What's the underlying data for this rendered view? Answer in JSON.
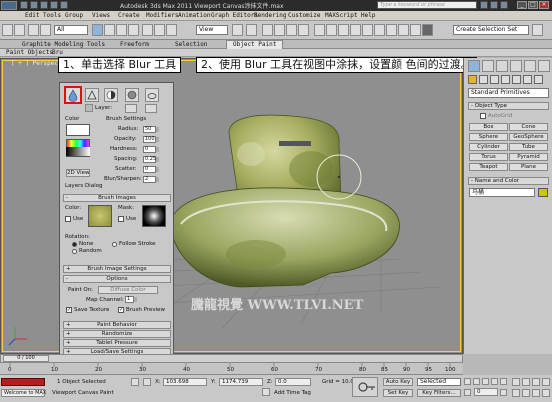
{
  "titlebar": {
    "title": "Autodesk 3ds Max  2011    Viewport Canvas涂抹文件.max",
    "search_placeholder": "Type a keyword or phrase"
  },
  "menubar": [
    "Edit",
    "Tools",
    "Group",
    "Views",
    "Create",
    "Modifiers",
    "Animation",
    "Graph Editors",
    "Rendering",
    "Customize",
    "MAXScript",
    "Help"
  ],
  "toolbar": {
    "filter_value": "All",
    "view_value": "View",
    "named_selection": "Create Selection Set"
  },
  "ribbon": {
    "tabs": [
      "Graphite Modeling Tools",
      "Freeform",
      "Selection",
      "Object Paint"
    ],
    "active_tab": "Object Paint",
    "sub": [
      "Paint Objects",
      "Bru"
    ]
  },
  "viewport": {
    "label": "[ + ] Perspective [ Smooth + Highlights ]",
    "label_short": "[ + ] Perspective",
    "watermark": "騰龍視覺 WWW.TLVI.NET",
    "highlight_color": "#f0d040"
  },
  "callouts": {
    "one": "1、单击选择 Blur 工具",
    "two": "2、使用 Blur 工具在视图中涂抹，设置颜 色间的过渡。"
  },
  "paint_panel": {
    "layer_label": "Layer:",
    "color_label": "Color",
    "brush_settings_label": "Brush Settings",
    "radius_label": "Radius:",
    "radius_value": "50",
    "opacity_label": "Opacity:",
    "opacity_value": "100",
    "hardness_label": "Hardness:",
    "hardness_value": "0",
    "spacing_label": "Spacing:",
    "spacing_value": "0.25",
    "scatter_label": "Scatter:",
    "scatter_value": "0",
    "blur_label": "Blur/Sharpen:",
    "blur_value": "2",
    "view_2d": "2D View",
    "layers_dialog": "Layers Dialog",
    "brush_images": "Brush Images",
    "color_sub": "Color:",
    "mask_sub": "Mask:",
    "use1": "Use",
    "use2": "Use",
    "rotation_label": "Rotation:",
    "rot_none": "None",
    "rot_follow": "Follow Stroke",
    "rot_random": "Random",
    "brush_image_settings": "Brush Image Settings",
    "options": "Options",
    "paint_on_label": "Paint On:",
    "paint_on_value": "Diffuse Color",
    "map_channel_label": "Map Channel:",
    "map_channel_value": "1",
    "save_texture": "Save Texture",
    "brush_preview": "Brush Preview",
    "paint_behavior": "Paint Behavior",
    "randomize": "Randomize",
    "tablet_pressure": "Tablet Pressure",
    "load_save": "Load/Save Settings"
  },
  "command_panel": {
    "dropdown": "Standard Primitives",
    "object_type_header": "Object Type",
    "autogrid": "AutoGrid",
    "buttons": [
      "Box",
      "Cone",
      "Sphere",
      "GeoSphere",
      "Cylinder",
      "Tube",
      "Torus",
      "Pyramid",
      "Teapot",
      "Plane"
    ],
    "name_color_header": "Name and Color",
    "name_value": "马桶",
    "object_color": "#c8c800"
  },
  "timeline": {
    "frame": "0 / 100",
    "ticks": [
      "0",
      "10",
      "20",
      "30",
      "40",
      "50",
      "60",
      "70",
      "80",
      "85",
      "90",
      "95",
      "100"
    ]
  },
  "status": {
    "selection": "1 Object Selected",
    "hint": "Viewport Canvas Paint",
    "welcome": "Welcome to MAX",
    "x_label": "X:",
    "x_value": "103.698",
    "y_label": "Y:",
    "y_value": "1174.739",
    "z_label": "Z:",
    "z_value": "0.0",
    "grid_label": "Grid = 10.0",
    "add_time_tag": "Add Time Tag",
    "auto_key": "Auto Key",
    "set_key": "Set Key",
    "selected": "Selected",
    "key_filters": "Key Filters...",
    "frame_field": "0"
  }
}
